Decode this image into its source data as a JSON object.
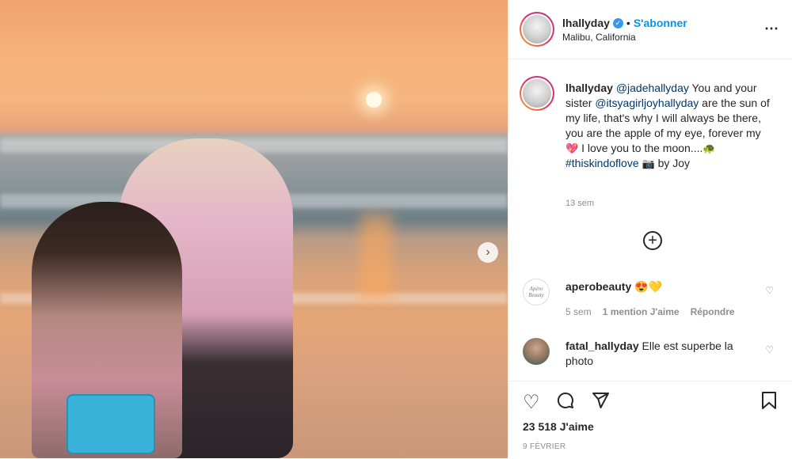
{
  "post": {
    "username": "lhallyday",
    "follow_label": "S'abonner",
    "location": "Malibu, California",
    "more_icon": "⋯",
    "caption": {
      "mention1": "@jadehallyday",
      "text1": " You and your sister ",
      "mention2": "@itsyagirljoyhallyday",
      "text2": " are the sun of my life, that's why I will always be there, you are the apple of my eye, forever my ",
      "heart_emoji": "💖",
      "text3": " I love you to the moon....",
      "turtle_emoji": "🐢",
      "text4": " ",
      "hashtag": "#thiskindoflove",
      "camera_emoji": "📷",
      "text5": " by Joy"
    },
    "time": "13 sem"
  },
  "comments": [
    {
      "username": "aperobeauty",
      "avatar_text": "Apéro Beauty",
      "text": "😍💛",
      "time": "5 sem",
      "likes": "1 mention J'aime",
      "reply": "Répondre"
    },
    {
      "username": "fatal_hallyday",
      "text": "Elle est superbe la photo"
    }
  ],
  "stats": {
    "likes": "23 518 J'aime",
    "date": "9 FÉVRIER"
  },
  "colors": {
    "accent": "#0095f6",
    "mention": "#00376b",
    "muted": "#8e8e8e",
    "verified": "#3897f0"
  },
  "icons": [
    "heart-icon",
    "comment-icon",
    "share-icon",
    "bookmark-icon",
    "next-arrow-icon",
    "add-comment-icon",
    "more-icon",
    "verified-icon"
  ]
}
